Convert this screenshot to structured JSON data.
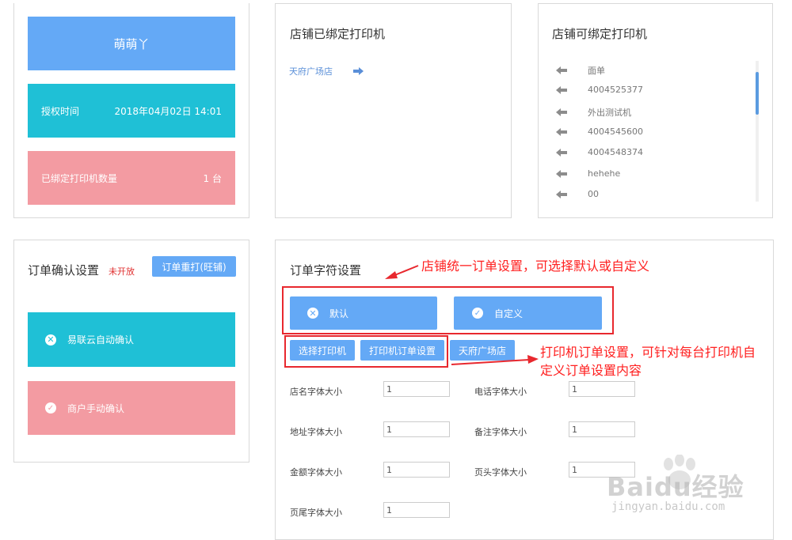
{
  "account": {
    "name": "萌萌丫",
    "auth_label": "授权时间",
    "auth_time": "2018年04月02日 14:01",
    "bound_count_label": "已绑定打印机数量",
    "bound_count_value": "1 台"
  },
  "bound_printers": {
    "title": "店铺已绑定打印机",
    "items": [
      {
        "name": "天府广场店"
      }
    ]
  },
  "available_printers": {
    "title": "店铺可绑定打印机",
    "items": [
      "面单",
      "4004525377",
      "外出测试机",
      "4004545600",
      "4004548374",
      "hehehe",
      "00"
    ]
  },
  "order_confirm": {
    "title": "订单确认设置",
    "not_open": "未开放",
    "reprint_button": "订单重打(旺铺)",
    "auto_confirm": "易联云自动确认",
    "manual_confirm": "商户手动确认"
  },
  "order_chars": {
    "title": "订单字符设置",
    "default_button": "默认",
    "custom_button": "自定义",
    "select_printer_button": "选择打印机",
    "printer_order_settings_button": "打印机订单设置",
    "store_button": "天府广场店",
    "fields": [
      {
        "label": "店名字体大小",
        "value": "1"
      },
      {
        "label": "电话字体大小",
        "value": "1"
      },
      {
        "label": "地址字体大小",
        "value": "1"
      },
      {
        "label": "备注字体大小",
        "value": "1"
      },
      {
        "label": "金额字体大小",
        "value": "1"
      },
      {
        "label": "页头字体大小",
        "value": "1"
      },
      {
        "label": "页尾字体大小",
        "value": "1"
      }
    ]
  },
  "annotations": {
    "note1": "店铺统一订单设置，可选择默认或自定义",
    "note2_line1": "打印机订单设置，可针对每台打印机自",
    "note2_line2": "定义订单设置内容"
  },
  "watermark": {
    "brand": "Baidu经验",
    "url": "jingyan.baidu.com"
  },
  "colors": {
    "blue_header": "#64a9f6",
    "teal": "#1fc0d6",
    "pink": "#f39ba2",
    "annotation_red": "#ff2020",
    "link_blue": "#5a8fd8"
  }
}
